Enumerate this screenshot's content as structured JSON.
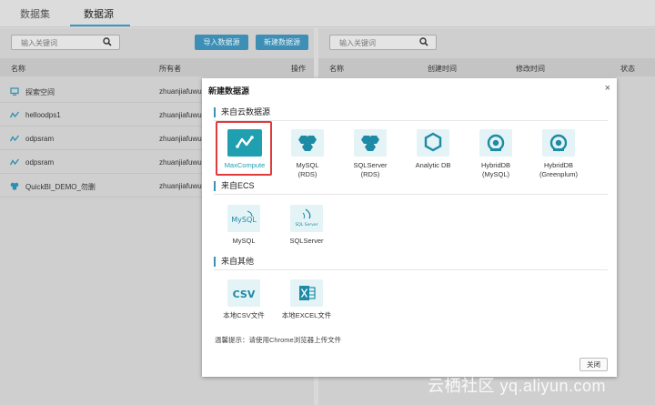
{
  "tabs": [
    {
      "label": "数据集",
      "active": false
    },
    {
      "label": "数据源",
      "active": true
    }
  ],
  "left": {
    "search_placeholder": "输入关键词",
    "import_button": "导入数据源",
    "new_button": "新建数据源",
    "headers": {
      "name": "名称",
      "owner": "所有者",
      "ops": "操作"
    },
    "rows": [
      {
        "name": "探索空间",
        "owner": "zhuanjiafuwu",
        "icon": "explore-space-icon"
      },
      {
        "name": "helloodps1",
        "owner": "zhuanjiafuwu",
        "icon": "maxcompute-icon"
      },
      {
        "name": "odpsram",
        "owner": "zhuanjiafuwu",
        "icon": "maxcompute-icon"
      },
      {
        "name": "odpsram",
        "owner": "zhuanjiafuwu",
        "icon": "maxcompute-icon"
      },
      {
        "name": "QuickBI_DEMO_勿删",
        "owner": "zhuanjiafuwu",
        "icon": "rds-icon"
      }
    ]
  },
  "right": {
    "search_placeholder": "输入关键词",
    "headers": {
      "name": "名称",
      "created": "创建时间",
      "modified": "修改时间",
      "status": "状态"
    }
  },
  "modal": {
    "title": "新建数据源",
    "close_symbol": "×",
    "sections": [
      {
        "title": "来自云数据源",
        "items": [
          {
            "label": "MaxCompute",
            "label2": "",
            "icon": "maxcompute-icon",
            "selected": true
          },
          {
            "label": "MySQL",
            "label2": "(RDS)",
            "icon": "rds-icon"
          },
          {
            "label": "SQLServer",
            "label2": "(RDS)",
            "icon": "rds-icon"
          },
          {
            "label": "Analytic DB",
            "label2": "",
            "icon": "analyticdb-icon"
          },
          {
            "label": "HybridDB",
            "label2": "(MySQL)",
            "icon": "hybriddb-icon"
          },
          {
            "label": "HybridDB",
            "label2": "(Greenplum)",
            "icon": "hybriddb-icon"
          }
        ]
      },
      {
        "title": "来自ECS",
        "items": [
          {
            "label": "MySQL",
            "icon": "mysql-icon",
            "icon_text": "MySQL"
          },
          {
            "label": "SQLServer",
            "icon": "sqlserver-icon",
            "icon_text": "SQL Server"
          }
        ]
      },
      {
        "title": "来自其他",
        "items": [
          {
            "label": "本地CSV文件",
            "icon": "csv-file-icon",
            "icon_text": "CSV"
          },
          {
            "label": "本地EXCEL文件",
            "icon": "excel-file-icon"
          }
        ]
      }
    ],
    "tip": "温馨提示：请使用Chrome浏览器上传文件",
    "close_button": "关闭"
  },
  "watermark": "云栖社区 yq.aliyun.com",
  "colors": {
    "accent": "#3d8fb6",
    "teal": "#1f9fb0",
    "highlight": "#e23b3b",
    "overlay_bg": "#d9d9d9"
  }
}
